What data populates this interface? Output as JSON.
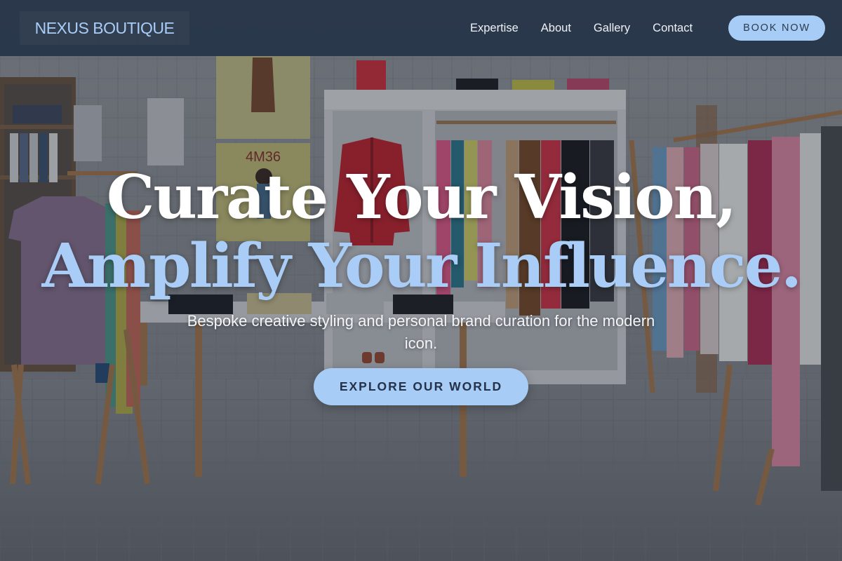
{
  "brand": {
    "name": "NEXUS BOUTIQUE"
  },
  "nav": {
    "items": [
      {
        "label": "Expertise"
      },
      {
        "label": "About"
      },
      {
        "label": "Gallery"
      },
      {
        "label": "Contact"
      }
    ],
    "cta_label": "BOOK NOW"
  },
  "hero": {
    "headline_line1": "Curate Your Vision,",
    "headline_line2": "Amplify Your Influence.",
    "subtitle": "Bespoke creative styling and personal brand curation for the modern icon.",
    "cta_label": "EXPLORE OUR WORLD"
  },
  "background": {
    "poster_text": "4M36"
  },
  "colors": {
    "accent": "#a7cdf7",
    "header_bg": "#263448",
    "button_text": "#25324a"
  }
}
